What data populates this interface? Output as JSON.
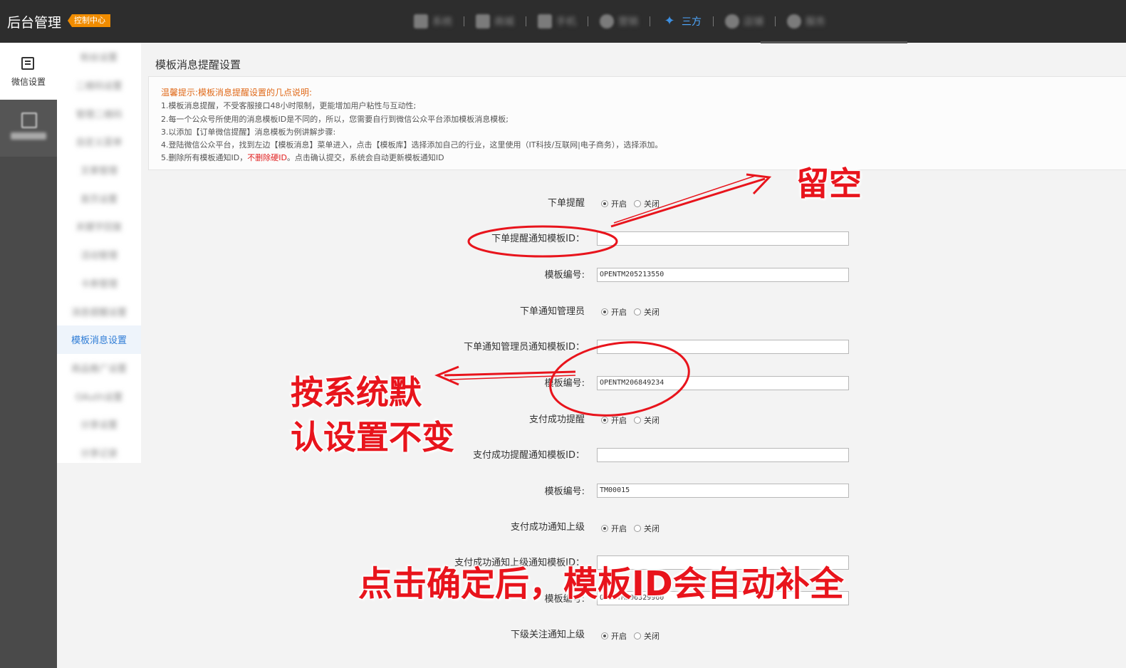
{
  "topbar": {
    "brand": "后台管理",
    "badge": "控制中心",
    "nav": [
      {
        "label": "系统",
        "icon": "grid-icon"
      },
      {
        "label": "商城",
        "icon": "store-icon"
      },
      {
        "label": "手机",
        "icon": "mobile-icon"
      },
      {
        "label": "营销",
        "icon": "gauge-icon"
      },
      {
        "label": "三方",
        "icon": "star-icon",
        "active": true
      },
      {
        "label": "店铺",
        "icon": "basket-icon"
      },
      {
        "label": "服务",
        "icon": "package-icon"
      }
    ]
  },
  "leftcol": {
    "top_label": "微信设置",
    "second_label": "模板消息"
  },
  "sidebar": {
    "items": [
      "粉丝设置",
      "二维码设置",
      "管理二维码",
      "自定义菜单",
      "文章管理",
      "首页设置",
      "关键字回复",
      "活动管理",
      "卡券管理",
      "消息提醒设置",
      "模板消息设置",
      "商品推广设置",
      "OAuth设置",
      "分享设置",
      "分享记录"
    ],
    "active_index": 10
  },
  "page": {
    "title": "模板消息提醒设置",
    "tips_head": "温馨提示:模板消息提醒设置的几点说明:",
    "tips": [
      "1.模板消息提醒，不受客服接口48小时限制，更能增加用户粘性与互动性;",
      "2.每一个公众号所使用的消息模板ID是不同的，所以，您需要自行到微信公众平台添加模板消息模板;",
      "3.以添加【订单微信提醒】消息模板为例讲解步骤:",
      "4.登陆微信公众平台，找到左边【模板消息】菜单进入，点击【模板库】选择添加自己的行业，这里使用（IT科技/互联网|电子商务），选择添加。"
    ],
    "tip5_a": "5.删除所有模板通知ID，",
    "tip5_red": "不删除硬ID",
    "tip5_b": "。点击确认提交，系统会自动更新模板通知ID"
  },
  "form": {
    "on": "开启",
    "off": "关闭",
    "order_remind": "下单提醒",
    "order_tpl_id": "下单提醒通知模板ID：",
    "tpl_no": "模板编号:",
    "order_tpl_no": "OPENTM205213550",
    "notify_admin": "下单通知管理员",
    "admin_tpl_id": "下单通知管理员通知模板ID：",
    "admin_tpl_no": "OPENTM206849234",
    "pay_remind": "支付成功提醒",
    "pay_tpl_id": "支付成功提醒通知模板ID：",
    "pay_tpl_no": "TM00015",
    "pay_superior": "支付成功通知上级",
    "pay_superior_tpl_id": "支付成功通知上级通知模板ID：",
    "superior_tpl_no": "OPENTM206329960",
    "follow_superior": "下级关注通知上级"
  },
  "annotations": {
    "leave_empty": "留空",
    "keep_default_1": "按系统默",
    "keep_default_2": "认设置不变",
    "auto_fill": "点击确定后，模板ID会自动补全",
    "color": "#e8141c"
  }
}
